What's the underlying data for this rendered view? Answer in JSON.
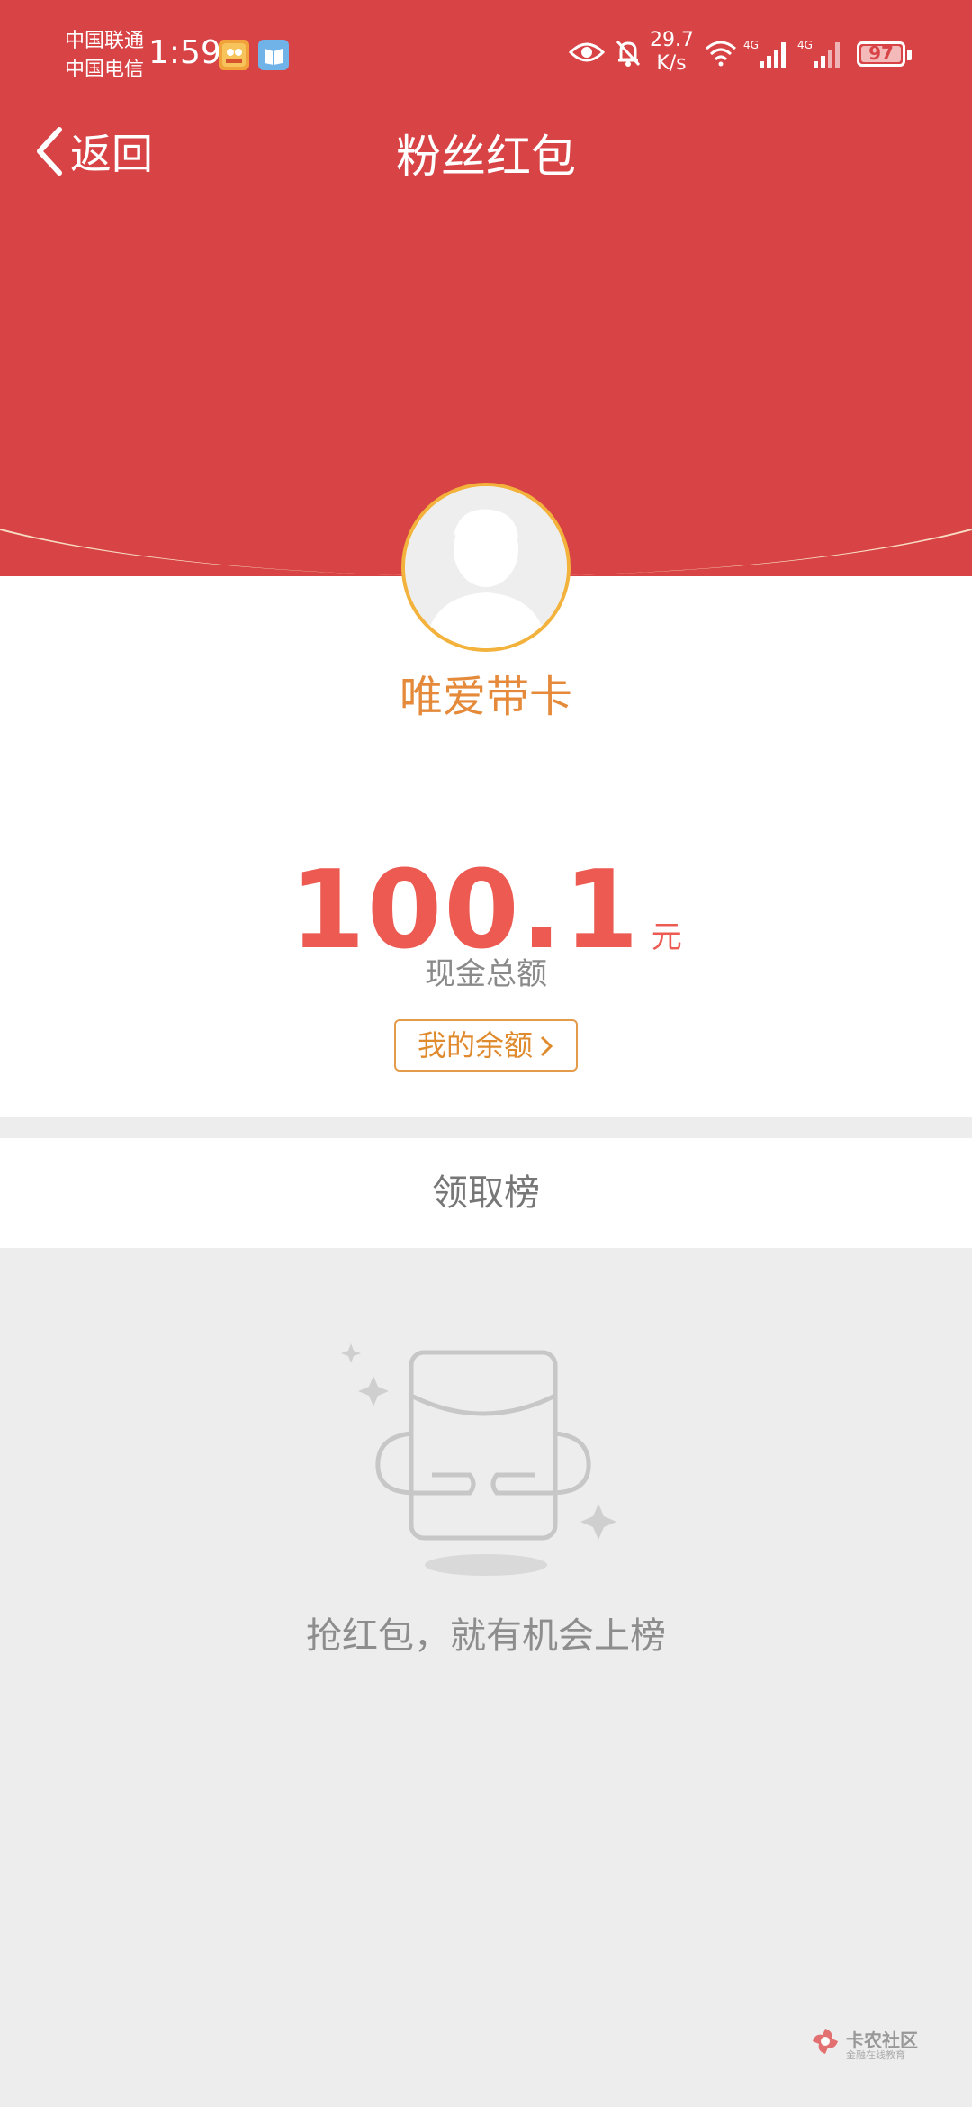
{
  "status_bar": {
    "carrier_1": "中国联通",
    "carrier_2": "中国电信",
    "time": "1:59",
    "net_speed_value": "29.7",
    "net_speed_unit": "K/s",
    "battery": "97",
    "icons": [
      "app-icon-1",
      "app-icon-2",
      "eye-icon",
      "bell-off-icon",
      "wifi-icon",
      "signal-4g-icon",
      "signal-4g-icon",
      "battery-icon"
    ]
  },
  "nav": {
    "back_label": "返回",
    "title": "粉丝红包"
  },
  "profile": {
    "username": "唯爱带卡"
  },
  "amount": {
    "value": "100.1",
    "unit": "元",
    "caption": "现金总额",
    "balance_button": "我的余额"
  },
  "leaderboard": {
    "title": "领取榜",
    "empty_text": "抢红包，就有机会上榜"
  },
  "watermark": {
    "name": "卡农社区",
    "sub": "金融在线教育"
  },
  "colors": {
    "header_red": "#d84346",
    "accent_orange": "#e58a3a",
    "amount_red": "#ec5a52",
    "background_gray": "#ededed"
  }
}
